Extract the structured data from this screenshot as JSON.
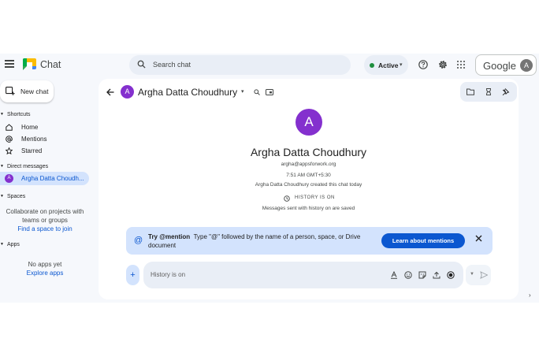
{
  "topbar": {
    "app_title": "Chat",
    "search_placeholder": "Search chat",
    "status_label": "Active",
    "account_label": "Google",
    "account_initial": "A"
  },
  "sidebar": {
    "new_chat_label": "New chat",
    "shortcuts_heading": "Shortcuts",
    "shortcuts": [
      {
        "label": "Home",
        "icon": "home-icon"
      },
      {
        "label": "Mentions",
        "icon": "at-icon"
      },
      {
        "label": "Starred",
        "icon": "star-icon"
      }
    ],
    "dm_heading": "Direct messages",
    "dm_item": {
      "initial": "A",
      "label": "Argha Datta Choudh..."
    },
    "spaces_heading": "Spaces",
    "spaces_text_1": "Collaborate on projects with",
    "spaces_text_2": "teams or groups",
    "spaces_link": "Find a space to join",
    "apps_heading": "Apps",
    "apps_empty": "No apps yet",
    "apps_link": "Explore apps"
  },
  "chat": {
    "header_initial": "A",
    "header_name": "Argha Datta Choudhury",
    "big_initial": "A",
    "contact_name": "Argha Datta Choudhury",
    "email": "argha@appsforwork.org",
    "time": "7:51 AM GMT+5:30",
    "created_text": "Argha Datta Choudhury created this chat today",
    "history_heading": "HISTORY IS ON",
    "history_sub": "Messages sent with history on are saved"
  },
  "banner": {
    "title": "Try @mention",
    "body": "Type \"@\" followed by the name of a person, space, or Drive document",
    "button_label": "Learn about mentions"
  },
  "composer": {
    "plus_label": "+",
    "placeholder": "History is on"
  },
  "colors": {
    "accent": "#0b57d0",
    "avatar_purple": "#8430ce",
    "active_green": "#1e8e3e",
    "banner_bg": "#d3e3fd"
  }
}
